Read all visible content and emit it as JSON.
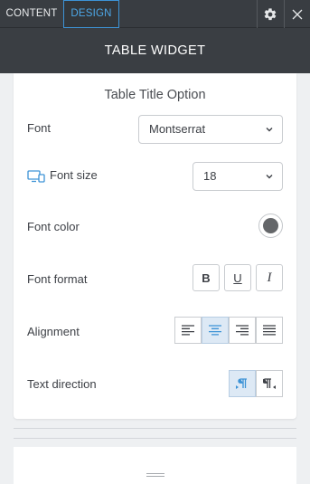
{
  "tabs": {
    "content": "CONTENT",
    "design": "DESIGN"
  },
  "header": {
    "title": "TABLE WIDGET"
  },
  "section": {
    "title": "Table Title Option"
  },
  "font": {
    "label": "Font",
    "value": "Montserrat"
  },
  "font_size": {
    "label": "Font size",
    "value": "18"
  },
  "font_color": {
    "label": "Font color",
    "swatch": "#646669"
  },
  "font_format": {
    "label": "Font format",
    "bold": "B",
    "underline": "U",
    "italic": "I"
  },
  "alignment": {
    "label": "Alignment",
    "selected": "center"
  },
  "text_direction": {
    "label": "Text direction",
    "selected": "ltr"
  },
  "colors": {
    "accent": "#3d93d6",
    "dark": "#3a3e43",
    "active_bg": "#dde9f5"
  }
}
